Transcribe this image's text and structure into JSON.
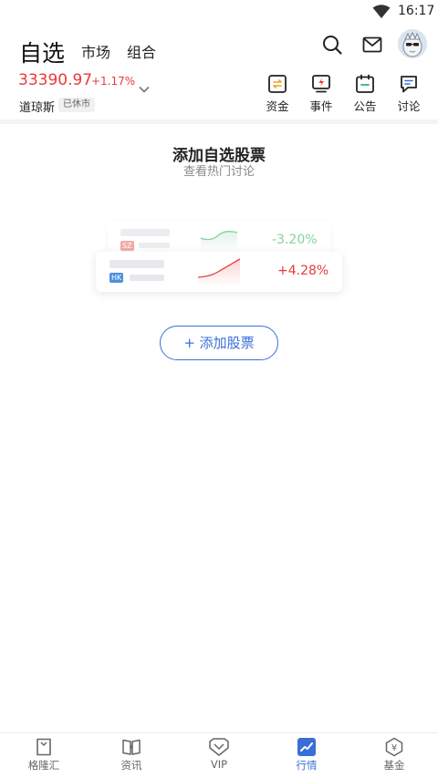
{
  "status_bar": {
    "time": "16:17"
  },
  "header": {
    "tabs": [
      {
        "label": "自选",
        "active": true
      },
      {
        "label": "市场"
      },
      {
        "label": "组合"
      }
    ]
  },
  "index": {
    "value": "33390.97",
    "change": "+1.17%",
    "name": "道琼斯",
    "status": "已休市"
  },
  "quick_actions": [
    {
      "label": "资金",
      "icon": "funds-icon"
    },
    {
      "label": "事件",
      "icon": "events-icon"
    },
    {
      "label": "公告",
      "icon": "announcement-icon"
    },
    {
      "label": "讨论",
      "icon": "discussion-icon"
    }
  ],
  "empty_state": {
    "title": "添加自选股票",
    "subtitle": "查看热门讨论",
    "example_cards": [
      {
        "market": "SZ",
        "change": "-3.20%"
      },
      {
        "market": "HK",
        "change": "+4.28%"
      }
    ],
    "add_button": "+ 添加股票"
  },
  "colors": {
    "up": "#e83a3a",
    "down": "#5dc47c",
    "accent": "#3a6fd8"
  },
  "bottom_nav": [
    {
      "label": "格隆汇",
      "icon": "gelonghui-icon"
    },
    {
      "label": "资讯",
      "icon": "news-icon"
    },
    {
      "label": "VIP",
      "icon": "vip-icon"
    },
    {
      "label": "行情",
      "icon": "quotes-icon",
      "active": true
    },
    {
      "label": "基金",
      "icon": "fund-icon"
    }
  ]
}
